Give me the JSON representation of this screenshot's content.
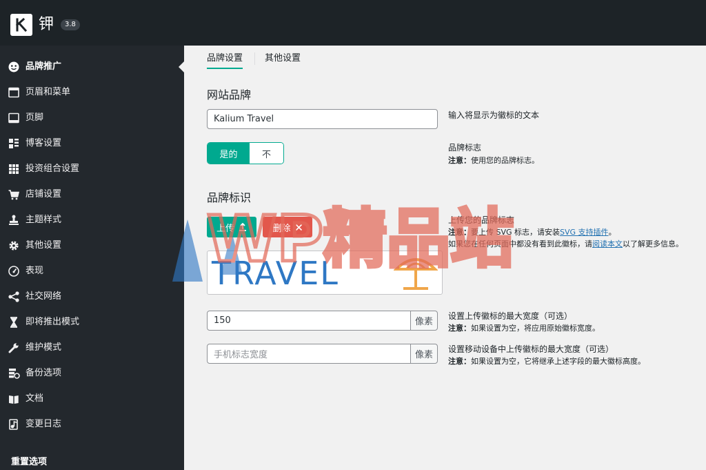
{
  "app": {
    "name": "钾",
    "version": "3.8"
  },
  "sidebar": {
    "items": [
      {
        "label": "品牌推广",
        "icon": "smiley-icon",
        "active": true
      },
      {
        "label": "页眉和菜单",
        "icon": "window-icon"
      },
      {
        "label": "页脚",
        "icon": "footer-icon"
      },
      {
        "label": "博客设置",
        "icon": "blog-layout-icon"
      },
      {
        "label": "投资组合设置",
        "icon": "grid-icon"
      },
      {
        "label": "店铺设置",
        "icon": "cart-icon"
      },
      {
        "label": "主题样式",
        "icon": "stamp-icon"
      },
      {
        "label": "其他设置",
        "icon": "gear-icon"
      },
      {
        "label": "表现",
        "icon": "dashboard-icon"
      },
      {
        "label": "社交网络",
        "icon": "share-icon"
      },
      {
        "label": "即将推出模式",
        "icon": "hourglass-icon"
      },
      {
        "label": "维护模式",
        "icon": "wrench-icon"
      },
      {
        "label": "备份选项",
        "icon": "backup-icon"
      },
      {
        "label": "文档",
        "icon": "book-icon"
      },
      {
        "label": "变更日志",
        "icon": "changelog-icon"
      }
    ],
    "reset_label": "重置选项"
  },
  "tabs": [
    {
      "label": "品牌设置",
      "active": true
    },
    {
      "label": "其他设置",
      "active": false
    }
  ],
  "brand": {
    "section_title": "网站品牌",
    "text_value": "Kalium Travel",
    "text_desc": "输入将显示为徽标的文本",
    "toggle_yes": "是的",
    "toggle_no": "不",
    "logo_title": "品牌标志",
    "logo_note_label": "注意：",
    "logo_note": "使用您的品牌标志。"
  },
  "identity": {
    "section_title": "品牌标识",
    "upload_label": "上传",
    "delete_label": "删除",
    "upload_title": "上传您的品牌标志",
    "upload_note_label": "注意：",
    "upload_note_pre": "要上传 SVG 标志，请安装",
    "upload_note_link": "SVG 支持插件",
    "upload_note_post": "。",
    "upload_note2_pre": "如果您在任何页面中都没有看到此徽标，请",
    "upload_note2_link": "阅读本文",
    "upload_note2_post": "以了解更多信息。",
    "preview_text": "TRAVEL",
    "max_width_value": "150",
    "unit": "像素",
    "max_width_title": "设置上传徽标的最大宽度（可选）",
    "max_width_note_label": "注意：",
    "max_width_note": "如果设置为空，将应用原始徽标宽度。",
    "mobile_placeholder": "手机标志宽度",
    "mobile_title": "设置移动设备中上传徽标的最大宽度（可选）",
    "mobile_note_label": "注意：",
    "mobile_note": "如果设置为空，它将继承上述字段的最大徽标高度。"
  },
  "watermark": {
    "text": "WP精品站"
  },
  "colors": {
    "accent": "#00a98f",
    "danger": "#e2574c",
    "sidebar": "#23282d",
    "link": "#2271b1"
  }
}
